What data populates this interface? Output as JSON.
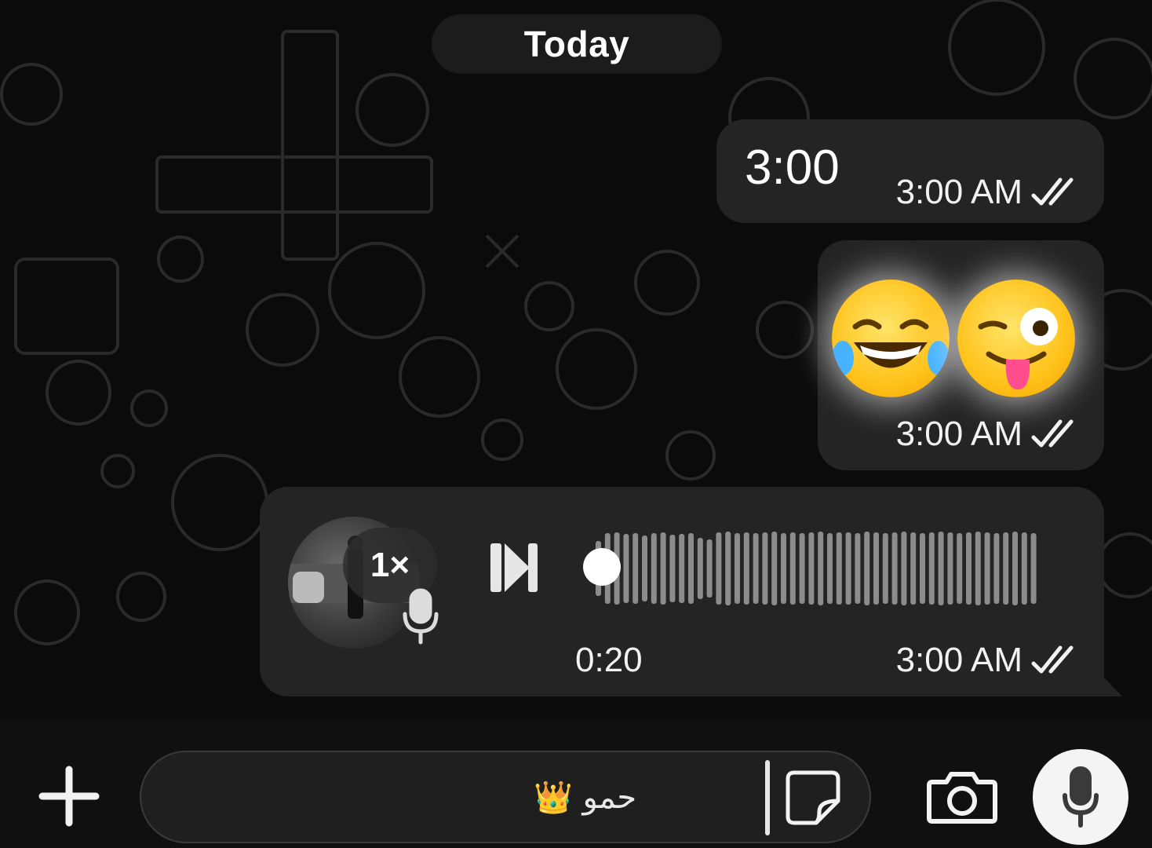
{
  "chat": {
    "date_label": "Today",
    "messages": [
      {
        "type": "text",
        "text": "3:00",
        "time": "3:00 AM",
        "status": "read"
      },
      {
        "type": "emoji",
        "emojis": [
          "face-with-tears-of-joy",
          "winking-face-with-tongue"
        ],
        "time": "3:00 AM",
        "status": "read"
      },
      {
        "type": "voice",
        "speed": "1×",
        "duration": "0:20",
        "time": "3:00 AM",
        "status": "read",
        "progress": 0
      }
    ]
  },
  "composer": {
    "input_value": "👑 حمو ",
    "icons": [
      "plus-icon",
      "sticker-icon",
      "camera-icon",
      "mic-icon"
    ]
  },
  "colors": {
    "bubble": "#242424",
    "background": "#0b0b0b",
    "text": "#ffffff"
  }
}
